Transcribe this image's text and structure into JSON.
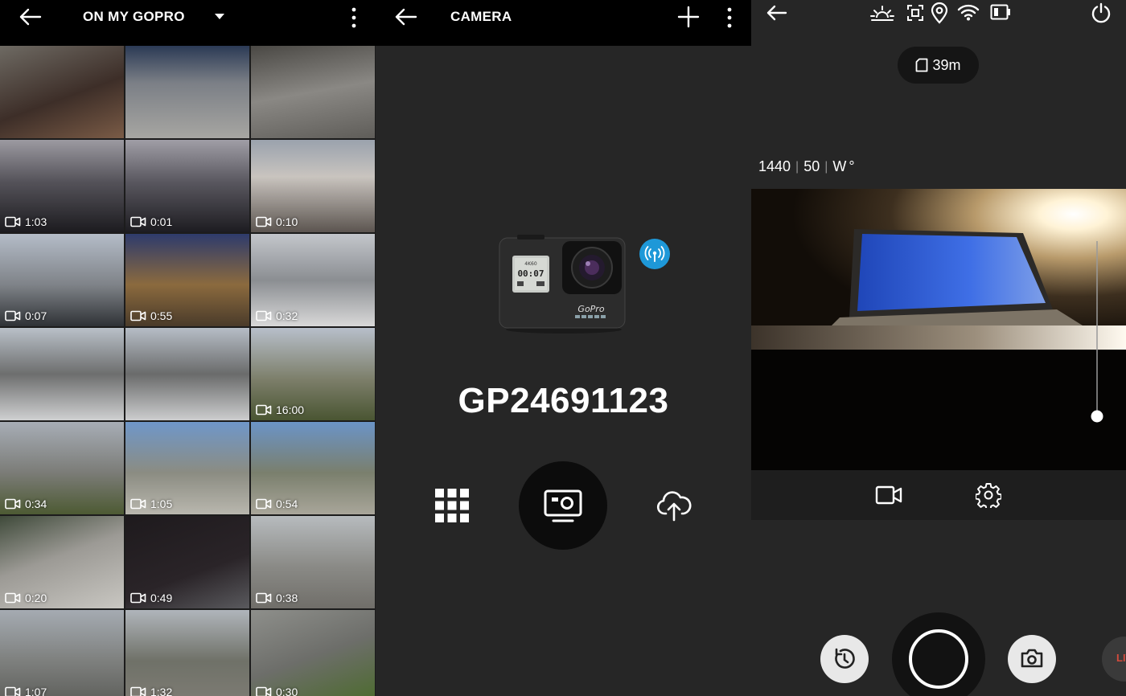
{
  "media_panel": {
    "title": "ON MY GOPRO",
    "icons": {
      "back": "arrow-left-icon",
      "dropdown": "caret-down-icon",
      "menu": "more-vertical-icon",
      "video": "video-camera-icon"
    },
    "tiles": [
      {
        "duration": "",
        "bg": "linear-gradient(160deg,#6e6a63 0%,#3d2e28 55%,#7a5b46 100%)"
      },
      {
        "duration": "",
        "bg": "linear-gradient(180deg,#2b3a55 0%,#7b7f86 40%,#a7a6a2 100%)"
      },
      {
        "duration": "",
        "bg": "linear-gradient(170deg,#4a4844 0%,#8a8884 50%,#5f5d59 100%)"
      },
      {
        "duration": "1:03",
        "bg": "linear-gradient(180deg,#9c9aa1 0%,#55535a 45%,#1c1b1f 100%)"
      },
      {
        "duration": "0:01",
        "bg": "linear-gradient(180deg,#a09ea6 0%,#5a5860 45%,#1d1c21 100%)"
      },
      {
        "duration": "0:10",
        "bg": "linear-gradient(180deg,#9aa2ad 0%,#c9c4bf 40%,#5c5550 100%)"
      },
      {
        "duration": "0:07",
        "bg": "linear-gradient(180deg,#b4bcc8 0%,#7f8388 55%,#2f3236 100%)"
      },
      {
        "duration": "0:55",
        "bg": "linear-gradient(180deg,#2e3b6c 0%,#8b6a3e 55%,#4a3b2a 100%)"
      },
      {
        "duration": "0:32",
        "bg": "linear-gradient(180deg,#c3c6cb 0%,#8b8e92 50%,#d8d8d8 100%)"
      },
      {
        "duration": "",
        "bg": "linear-gradient(180deg,#b9c0c8 0%,#6d6e6e 50%,#cfd0d1 100%)"
      },
      {
        "duration": "",
        "bg": "linear-gradient(180deg,#b6bdc6 0%,#6a6b6b 50%,#cccdce 100%)"
      },
      {
        "duration": "16:00",
        "bg": "linear-gradient(180deg,#b7bfca 0%,#7d7f6b 55%,#4a5532 100%)"
      },
      {
        "duration": "0:34",
        "bg": "linear-gradient(180deg,#a7adb6 0%,#7b7c77 55%,#4d5a33 100%)"
      },
      {
        "duration": "1:05",
        "bg": "linear-gradient(180deg,#6f97c9 0%,#8b8c82 55%,#b9b7ae 100%)"
      },
      {
        "duration": "0:54",
        "bg": "linear-gradient(180deg,#6b94c7 0%,#7a7f6d 55%,#a9a69a 100%)"
      },
      {
        "duration": "0:20",
        "bg": "linear-gradient(160deg,#3f4a3a 0%,#9c9a95 45%,#c9c7c2 100%)"
      },
      {
        "duration": "0:49",
        "bg": "linear-gradient(160deg,#1e1a1d 0%,#2a2428 60%,#5a5a5e 100%)"
      },
      {
        "duration": "0:38",
        "bg": "linear-gradient(180deg,#b7bbbe 0%,#8a8a86 55%,#706e69 100%)"
      },
      {
        "duration": "1:07",
        "bg": "linear-gradient(180deg,#a5abb2 0%,#7e807e 55%,#5d5e5a 100%)"
      },
      {
        "duration": "1:32",
        "bg": "linear-gradient(180deg,#b0b5bb 0%,#6f7168 55%,#7e7c74 100%)"
      },
      {
        "duration": "0:30",
        "bg": "linear-gradient(160deg,#8e8f8b 0%,#6d6e6a 50%,#4c6b2d 100%)"
      }
    ]
  },
  "camera_panel": {
    "title": "CAMERA",
    "camera_name": "GP24691123",
    "icons": {
      "back": "arrow-left-icon",
      "add": "plus-icon",
      "menu": "more-vertical-icon",
      "wireless": "wireless-icon",
      "media": "grid-icon",
      "preview": "camera-preview-icon",
      "upload": "cloud-upload-icon"
    },
    "accent": "#1e98d8"
  },
  "viewfinder_panel": {
    "storage_remaining": "39m",
    "resolution": "1440",
    "fps": "50",
    "fov": "W",
    "fov_suffix": "°",
    "live_label": "LIV",
    "icons": {
      "back": "arrow-left-icon",
      "exposure": "sunrise-icon",
      "protune": "focus-frame-icon",
      "gps": "location-pin-icon",
      "wifi": "wifi-icon",
      "battery": "battery-icon",
      "power": "power-icon",
      "sd": "sd-card-icon",
      "video_mode": "video-camera-icon",
      "settings": "gear-icon",
      "timer": "timer-icon",
      "shutter": "shutter-button",
      "photo": "camera-icon"
    }
  }
}
